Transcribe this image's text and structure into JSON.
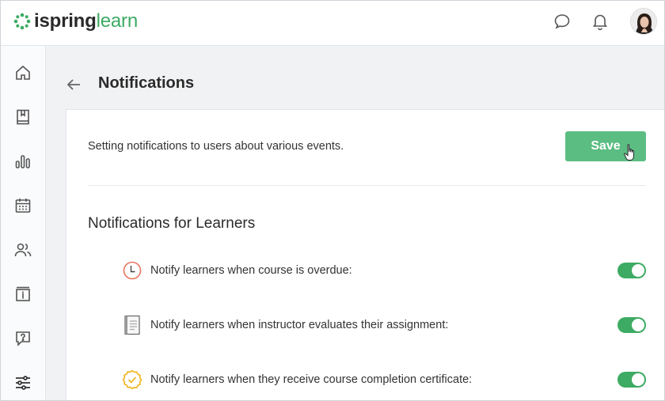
{
  "brand": {
    "name_part1": "ispring",
    "name_part2": "learn"
  },
  "header": {
    "icons": [
      "chat-icon",
      "bell-icon"
    ]
  },
  "sidebar": {
    "items": [
      "home-icon",
      "book-icon",
      "chart-icon",
      "calendar-icon",
      "users-icon",
      "catalog-icon",
      "help-icon",
      "settings-icon"
    ]
  },
  "page": {
    "title": "Notifications",
    "description": "Setting notifications to users about various events.",
    "save_label": "Save",
    "section_title": "Notifications for Learners"
  },
  "notifications": [
    {
      "icon": "clock-icon",
      "label": "Notify learners when course is overdue:",
      "enabled": true
    },
    {
      "icon": "notebook-icon",
      "label": "Notify learners when instructor evaluates their assignment:",
      "enabled": true
    },
    {
      "icon": "certificate-check-icon",
      "label": "Notify learners when they receive course completion certificate:",
      "enabled": true
    }
  ],
  "colors": {
    "accent": "#3dab63",
    "save_button": "#5cbd83",
    "page_bg": "#f1f2f4"
  }
}
